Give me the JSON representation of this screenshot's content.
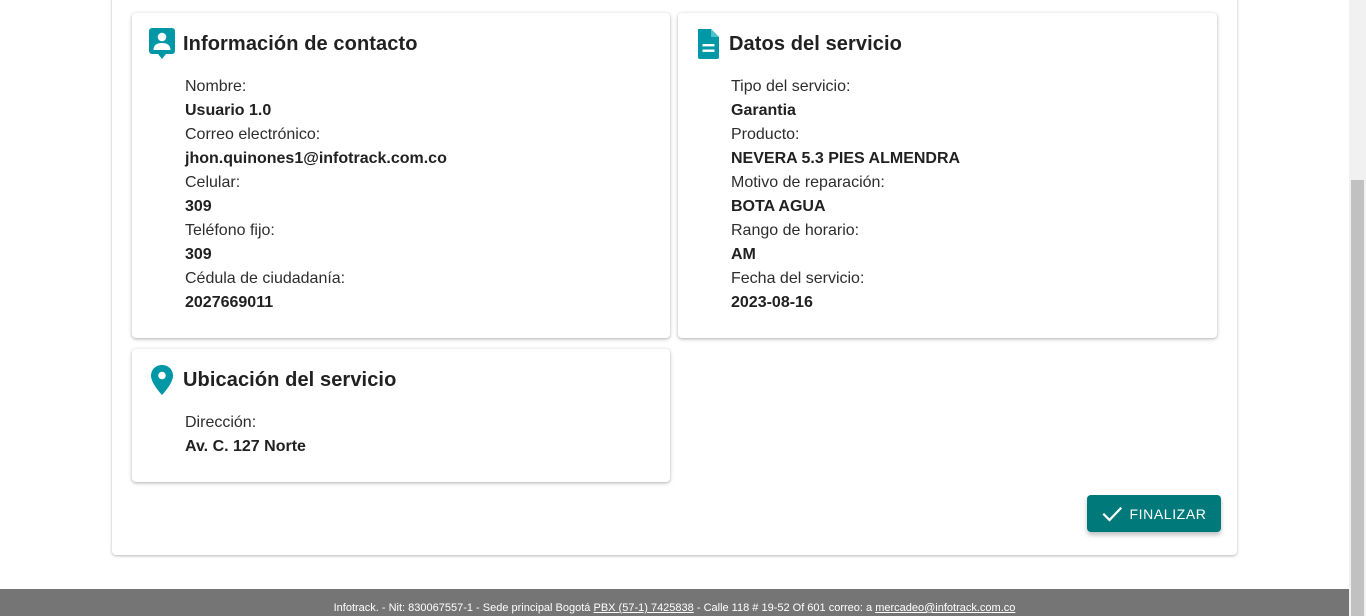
{
  "contact": {
    "title": "Información de contacto",
    "icon": "contact-person-icon",
    "fields": [
      {
        "label": "Nombre:",
        "value": "Usuario 1.0"
      },
      {
        "label": "Correo electrónico:",
        "value": "jhon.quinones1@infotrack.com.co"
      },
      {
        "label": "Celular:",
        "value": "309"
      },
      {
        "label": "Teléfono fijo:",
        "value": "309"
      },
      {
        "label": "Cédula de ciudadanía:",
        "value": "2027669011"
      }
    ]
  },
  "service": {
    "title": "Datos del servicio",
    "icon": "document-icon",
    "fields": [
      {
        "label": "Tipo del servicio:",
        "value": "Garantia"
      },
      {
        "label": "Producto:",
        "value": "NEVERA 5.3 PIES ALMENDRA"
      },
      {
        "label": "Motivo de reparación:",
        "value": "BOTA AGUA"
      },
      {
        "label": "Rango de horario:",
        "value": "AM"
      },
      {
        "label": "Fecha del servicio:",
        "value": "2023-08-16"
      }
    ]
  },
  "location": {
    "title": "Ubicación del servicio",
    "icon": "map-pin-icon",
    "fields": [
      {
        "label": "Dirección:",
        "value": "Av. C. 127 Norte"
      }
    ]
  },
  "actions": {
    "finalize_label": "FINALIZAR",
    "finalize_icon": "check-icon"
  },
  "footer": {
    "company": "Infotrack. - Nit: 830067557-1 - Sede principal Bogotá",
    "phone": "PBX (57-1) 7425838",
    "address": "- Calle 118 # 19-52 Of 601",
    "email_prefix": "correo: a",
    "email": "mercadeo@infotrack.com.co"
  },
  "colors": {
    "accent": "#00797a",
    "icon": "#0097a7",
    "footer_bg": "#757575"
  }
}
